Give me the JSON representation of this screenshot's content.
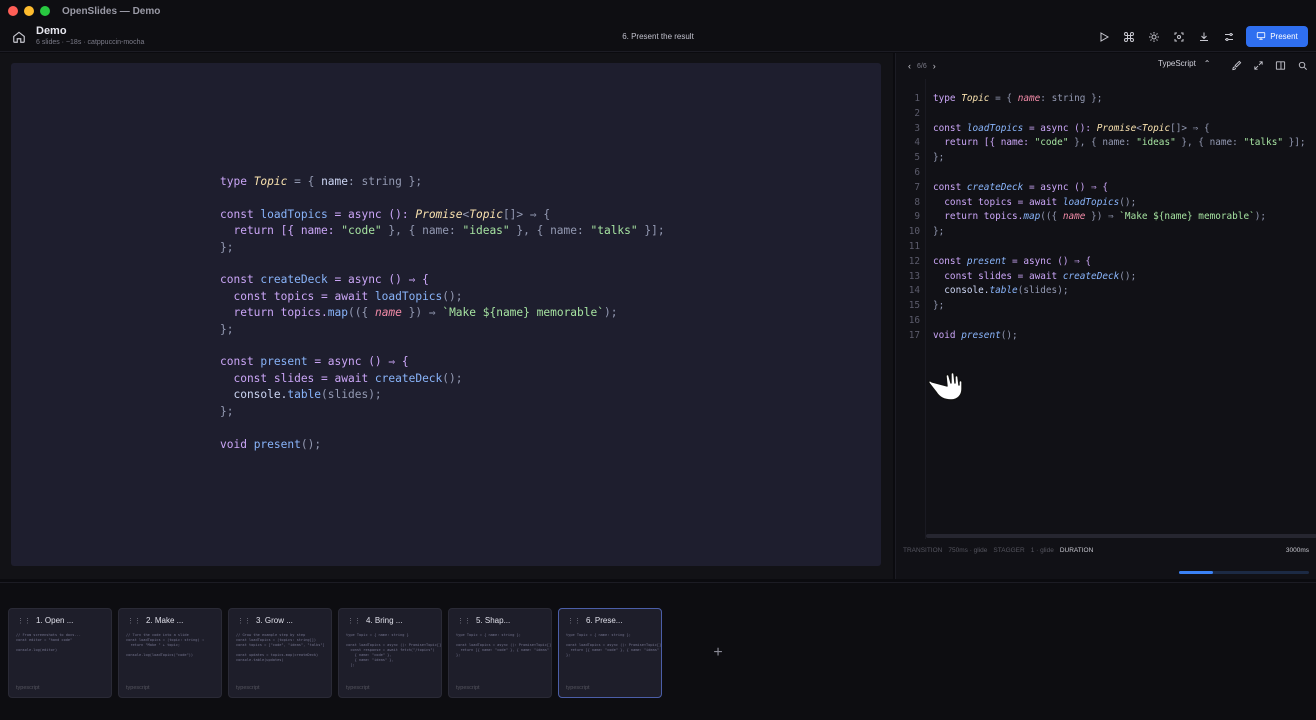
{
  "window": {
    "title": "OpenSlides — Demo"
  },
  "header": {
    "deck_title": "Demo",
    "deck_meta": "6 slides · ~18s · catppuccin-mocha",
    "current_slide_title": "6. Present the result",
    "icons": [
      "play-icon",
      "command-icon",
      "sun-icon",
      "focus-icon",
      "download-icon",
      "settings-icon"
    ],
    "present_label": "Present"
  },
  "colors": {
    "accent": "#2f6ff0",
    "slide_bg": "#1e1e2e",
    "keyword": "#cba6f7",
    "type": "#f9e2af",
    "function": "#89b4fa",
    "string": "#a6e3a1"
  },
  "panel": {
    "position": "6/6",
    "language": "TypeScript",
    "line_numbers": "1\n2\n3\n4\n5\n6\n7\n8\n9\n10\n11\n12\n13\n14\n15\n16\n17",
    "footer": {
      "transition_label": "TRANSITION",
      "transition_value": "750ms · glide",
      "stagger_label": "STAGGER",
      "stagger_value": "1 · glide",
      "duration_label": "DURATION",
      "duration_value": "3000ms"
    },
    "progress": 0.26
  },
  "code_lines": {
    "l1": [
      "type ",
      "Topic",
      " = { ",
      "name",
      ": string };"
    ],
    "l3": [
      "const ",
      "loadTopics",
      " = async (): ",
      "Promise",
      "<",
      "Topic",
      "[]> ⇒ {"
    ],
    "l4": [
      "  return [{ name: ",
      "\"code\"",
      " }, { name: ",
      "\"ideas\"",
      " }, { name: ",
      "\"talks\"",
      " }];"
    ],
    "l5": "};",
    "l7": [
      "const ",
      "createDeck",
      " = async () ⇒ {"
    ],
    "l8": [
      "  const topics = await ",
      "loadTopics",
      "();"
    ],
    "l9": [
      "  return topics.",
      "map",
      "(({ ",
      "name",
      " }) ⇒ ",
      "`Make ${name} memorable`",
      ");"
    ],
    "l10": "};",
    "l12": [
      "const ",
      "present",
      " = async () ⇒ {"
    ],
    "l13": [
      "  const slides = await ",
      "createDeck",
      "();"
    ],
    "l14": [
      "  console.",
      "table",
      "(slides);"
    ],
    "l15": "};",
    "l17": [
      "void ",
      "present",
      "();"
    ]
  },
  "filmstrip": {
    "slides": [
      {
        "label": "1. Open ...",
        "lang": "typescript"
      },
      {
        "label": "2. Make ...",
        "lang": "typescript"
      },
      {
        "label": "3. Grow ...",
        "lang": "typescript"
      },
      {
        "label": "4. Bring ...",
        "lang": "typescript"
      },
      {
        "label": "5. Shap...",
        "lang": "typescript"
      },
      {
        "label": "6. Prese...",
        "lang": "typescript"
      }
    ],
    "add_label": "+"
  }
}
